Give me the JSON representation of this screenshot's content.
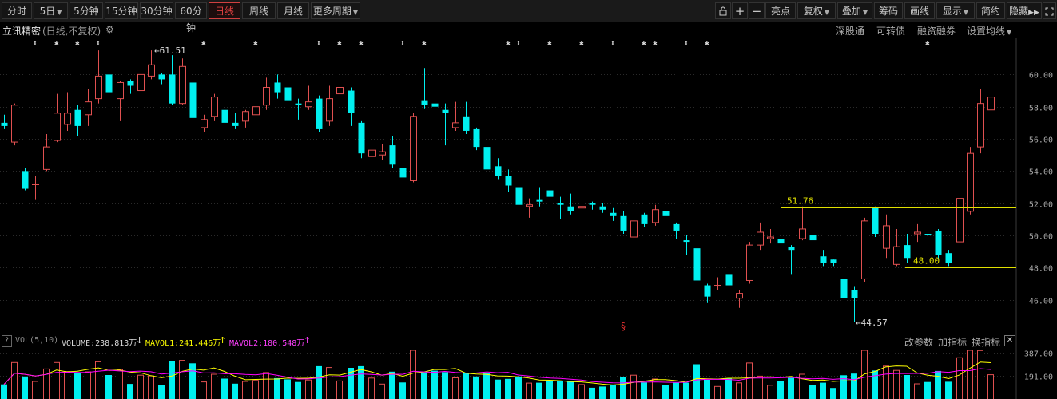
{
  "toolbar": {
    "period_tabs": [
      "分时",
      "5日",
      "5分钟",
      "15分钟",
      "30分钟",
      "60分钟",
      "日线",
      "周线",
      "月线"
    ],
    "active_tab": "日线",
    "more_periods": "更多周期",
    "right_items": [
      "亮点",
      "复权",
      "叠加",
      "筹码",
      "画线",
      "显示",
      "简约",
      "隐藏"
    ]
  },
  "stock": {
    "name": "立讯精密",
    "mode": "(日线,不复权)"
  },
  "top_links": [
    "深股通",
    "可转债",
    "融资融券",
    "设置均线"
  ],
  "chart_data": {
    "type": "candlestick",
    "y_ticks": [
      "60.00",
      "58.00",
      "56.00",
      "54.00",
      "52.00",
      "50.00",
      "48.00",
      "46.00"
    ],
    "ylim": [
      44.0,
      62.3
    ],
    "annotations": {
      "high_label": "61.51",
      "low_label": "44.57",
      "resistance_label": "51.76",
      "support_label": "48.00",
      "marker": "§"
    },
    "candles": [
      {
        "o": 57.0,
        "c": 56.8,
        "h": 57.5,
        "l": 56.6
      },
      {
        "o": 55.8,
        "c": 58.1,
        "h": 58.2,
        "l": 55.6
      },
      {
        "o": 54.0,
        "c": 52.9,
        "h": 54.2,
        "l": 52.8
      },
      {
        "o": 53.2,
        "c": 53.2,
        "h": 53.7,
        "l": 52.2
      },
      {
        "o": 54.1,
        "c": 55.5,
        "h": 56.3,
        "l": 54.0
      },
      {
        "o": 55.9,
        "c": 57.6,
        "h": 58.8,
        "l": 55.8
      },
      {
        "o": 56.9,
        "c": 57.6,
        "h": 58.9,
        "l": 56.5
      },
      {
        "o": 57.8,
        "c": 56.8,
        "h": 58.1,
        "l": 56.2
      },
      {
        "o": 57.5,
        "c": 58.3,
        "h": 59.1,
        "l": 56.8
      },
      {
        "o": 58.5,
        "c": 59.9,
        "h": 61.5,
        "l": 58.2
      },
      {
        "o": 60.0,
        "c": 58.9,
        "h": 60.2,
        "l": 58.6
      },
      {
        "o": 58.5,
        "c": 59.5,
        "h": 59.6,
        "l": 57.1
      },
      {
        "o": 59.6,
        "c": 59.3,
        "h": 59.7,
        "l": 58.8
      },
      {
        "o": 59.0,
        "c": 60.0,
        "h": 60.5,
        "l": 58.8
      },
      {
        "o": 59.9,
        "c": 60.6,
        "h": 61.5,
        "l": 59.7
      },
      {
        "o": 60.0,
        "c": 59.7,
        "h": 60.1,
        "l": 59.4
      },
      {
        "o": 60.0,
        "c": 58.2,
        "h": 61.2,
        "l": 58.1
      },
      {
        "o": 58.2,
        "c": 60.5,
        "h": 61.0,
        "l": 58.1
      },
      {
        "o": 59.5,
        "c": 57.3,
        "h": 59.6,
        "l": 57.1
      },
      {
        "o": 56.7,
        "c": 57.2,
        "h": 57.5,
        "l": 56.4
      },
      {
        "o": 57.4,
        "c": 58.6,
        "h": 58.8,
        "l": 57.1
      },
      {
        "o": 57.8,
        "c": 57.0,
        "h": 58.1,
        "l": 56.8
      },
      {
        "o": 57.0,
        "c": 56.8,
        "h": 57.6,
        "l": 56.6
      },
      {
        "o": 57.1,
        "c": 57.7,
        "h": 57.8,
        "l": 56.7
      },
      {
        "o": 57.5,
        "c": 58.0,
        "h": 58.5,
        "l": 57.2
      },
      {
        "o": 58.1,
        "c": 59.2,
        "h": 59.8,
        "l": 57.8
      },
      {
        "o": 59.5,
        "c": 58.9,
        "h": 60.0,
        "l": 58.5
      },
      {
        "o": 59.2,
        "c": 58.4,
        "h": 59.3,
        "l": 58.1
      },
      {
        "o": 58.2,
        "c": 58.1,
        "h": 58.5,
        "l": 57.2
      },
      {
        "o": 58.0,
        "c": 58.3,
        "h": 59.3,
        "l": 57.8
      },
      {
        "o": 58.5,
        "c": 56.6,
        "h": 58.7,
        "l": 56.4
      },
      {
        "o": 57.1,
        "c": 58.5,
        "h": 59.3,
        "l": 56.8
      },
      {
        "o": 58.8,
        "c": 59.2,
        "h": 59.5,
        "l": 58.2
      },
      {
        "o": 59.0,
        "c": 57.6,
        "h": 59.2,
        "l": 56.8
      },
      {
        "o": 57.0,
        "c": 55.1,
        "h": 57.1,
        "l": 54.8
      },
      {
        "o": 54.9,
        "c": 55.3,
        "h": 55.9,
        "l": 54.2
      },
      {
        "o": 55.0,
        "c": 55.2,
        "h": 55.7,
        "l": 54.7
      },
      {
        "o": 55.6,
        "c": 54.4,
        "h": 56.2,
        "l": 54.2
      },
      {
        "o": 54.2,
        "c": 53.6,
        "h": 54.3,
        "l": 53.4
      },
      {
        "o": 53.4,
        "c": 57.4,
        "h": 57.6,
        "l": 53.3
      },
      {
        "o": 58.4,
        "c": 58.1,
        "h": 60.4,
        "l": 57.9
      },
      {
        "o": 58.2,
        "c": 58.0,
        "h": 60.6,
        "l": 57.8
      },
      {
        "o": 57.8,
        "c": 57.6,
        "h": 58.2,
        "l": 55.6
      },
      {
        "o": 56.7,
        "c": 57.0,
        "h": 58.3,
        "l": 56.5
      },
      {
        "o": 57.4,
        "c": 56.5,
        "h": 58.3,
        "l": 56.3
      },
      {
        "o": 56.6,
        "c": 55.5,
        "h": 56.7,
        "l": 55.3
      },
      {
        "o": 55.5,
        "c": 54.1,
        "h": 55.6,
        "l": 53.9
      },
      {
        "o": 54.3,
        "c": 53.7,
        "h": 54.8,
        "l": 53.5
      },
      {
        "o": 53.7,
        "c": 53.1,
        "h": 54.1,
        "l": 52.7
      },
      {
        "o": 53.0,
        "c": 51.9,
        "h": 53.1,
        "l": 51.7
      },
      {
        "o": 51.8,
        "c": 51.9,
        "h": 52.3,
        "l": 51.1
      },
      {
        "o": 52.2,
        "c": 52.1,
        "h": 53.0,
        "l": 51.8
      },
      {
        "o": 52.8,
        "c": 52.4,
        "h": 53.5,
        "l": 52.2
      },
      {
        "o": 52.0,
        "c": 51.9,
        "h": 52.4,
        "l": 51.0
      },
      {
        "o": 51.8,
        "c": 51.5,
        "h": 52.6,
        "l": 51.3
      },
      {
        "o": 51.7,
        "c": 51.8,
        "h": 52.1,
        "l": 51.1
      },
      {
        "o": 52.0,
        "c": 51.9,
        "h": 52.1,
        "l": 51.6
      },
      {
        "o": 51.8,
        "c": 51.6,
        "h": 52.0,
        "l": 51.4
      },
      {
        "o": 51.4,
        "c": 51.2,
        "h": 51.7,
        "l": 50.9
      },
      {
        "o": 51.2,
        "c": 50.3,
        "h": 51.5,
        "l": 50.1
      },
      {
        "o": 49.9,
        "c": 50.9,
        "h": 51.3,
        "l": 49.6
      },
      {
        "o": 51.3,
        "c": 50.7,
        "h": 51.4,
        "l": 50.5
      },
      {
        "o": 50.8,
        "c": 51.6,
        "h": 51.9,
        "l": 50.6
      },
      {
        "o": 51.5,
        "c": 51.2,
        "h": 51.7,
        "l": 50.9
      },
      {
        "o": 50.7,
        "c": 50.3,
        "h": 50.8,
        "l": 49.8
      },
      {
        "o": 49.7,
        "c": 49.6,
        "h": 50.0,
        "l": 48.8
      },
      {
        "o": 49.2,
        "c": 47.2,
        "h": 49.4,
        "l": 46.9
      },
      {
        "o": 46.9,
        "c": 46.2,
        "h": 47.0,
        "l": 45.8
      },
      {
        "o": 46.9,
        "c": 46.9,
        "h": 47.4,
        "l": 46.6
      },
      {
        "o": 47.6,
        "c": 46.9,
        "h": 47.8,
        "l": 46.4
      },
      {
        "o": 46.1,
        "c": 46.4,
        "h": 46.6,
        "l": 45.5
      },
      {
        "o": 47.2,
        "c": 49.4,
        "h": 49.6,
        "l": 47.0
      },
      {
        "o": 49.4,
        "c": 50.2,
        "h": 50.8,
        "l": 49.1
      },
      {
        "o": 49.8,
        "c": 49.9,
        "h": 50.4,
        "l": 49.5
      },
      {
        "o": 49.8,
        "c": 49.5,
        "h": 50.5,
        "l": 49.2
      },
      {
        "o": 49.3,
        "c": 49.1,
        "h": 49.4,
        "l": 47.6
      },
      {
        "o": 49.8,
        "c": 50.4,
        "h": 51.8,
        "l": 49.7
      },
      {
        "o": 50.0,
        "c": 49.7,
        "h": 50.2,
        "l": 49.4
      },
      {
        "o": 48.7,
        "c": 48.3,
        "h": 49.1,
        "l": 48.1
      },
      {
        "o": 48.5,
        "c": 48.3,
        "h": 48.5,
        "l": 48.1
      },
      {
        "o": 47.3,
        "c": 46.1,
        "h": 47.4,
        "l": 45.9
      },
      {
        "o": 46.6,
        "c": 46.1,
        "h": 46.8,
        "l": 44.6
      },
      {
        "o": 47.3,
        "c": 50.9,
        "h": 51.1,
        "l": 47.1
      },
      {
        "o": 51.7,
        "c": 50.1,
        "h": 51.8,
        "l": 49.9
      },
      {
        "o": 49.2,
        "c": 50.6,
        "h": 51.3,
        "l": 48.6
      },
      {
        "o": 48.2,
        "c": 49.3,
        "h": 50.4,
        "l": 48.1
      },
      {
        "o": 49.4,
        "c": 48.6,
        "h": 50.1,
        "l": 48.3
      },
      {
        "o": 50.1,
        "c": 50.2,
        "h": 50.7,
        "l": 49.6
      },
      {
        "o": 50.1,
        "c": 50.0,
        "h": 50.5,
        "l": 49.2
      },
      {
        "o": 50.3,
        "c": 48.8,
        "h": 50.4,
        "l": 48.5
      },
      {
        "o": 48.9,
        "c": 48.3,
        "h": 49.1,
        "l": 48.1
      },
      {
        "o": 49.6,
        "c": 52.3,
        "h": 52.6,
        "l": 49.6
      },
      {
        "o": 51.5,
        "c": 55.1,
        "h": 55.5,
        "l": 51.3
      },
      {
        "o": 55.5,
        "c": 58.2,
        "h": 59.1,
        "l": 55.1
      },
      {
        "o": 57.8,
        "c": 58.6,
        "h": 59.5,
        "l": 57.6
      }
    ],
    "volume": {
      "label": "VOL(5,10)",
      "volume_text": "VOLUME:238.813万",
      "mavol1_text": "MAVOL1:241.446万",
      "mavol2_text": "MAVOL2:180.548万",
      "y_ticks": [
        "387.00",
        "191.00"
      ]
    }
  },
  "vol_links": [
    "改参数",
    "加指标",
    "换指标"
  ],
  "colors": {
    "up": "#e05050",
    "down": "#00f0f0",
    "accent": "#d04040",
    "mavol1": "#ffff00",
    "mavol2": "#ff00ff"
  }
}
